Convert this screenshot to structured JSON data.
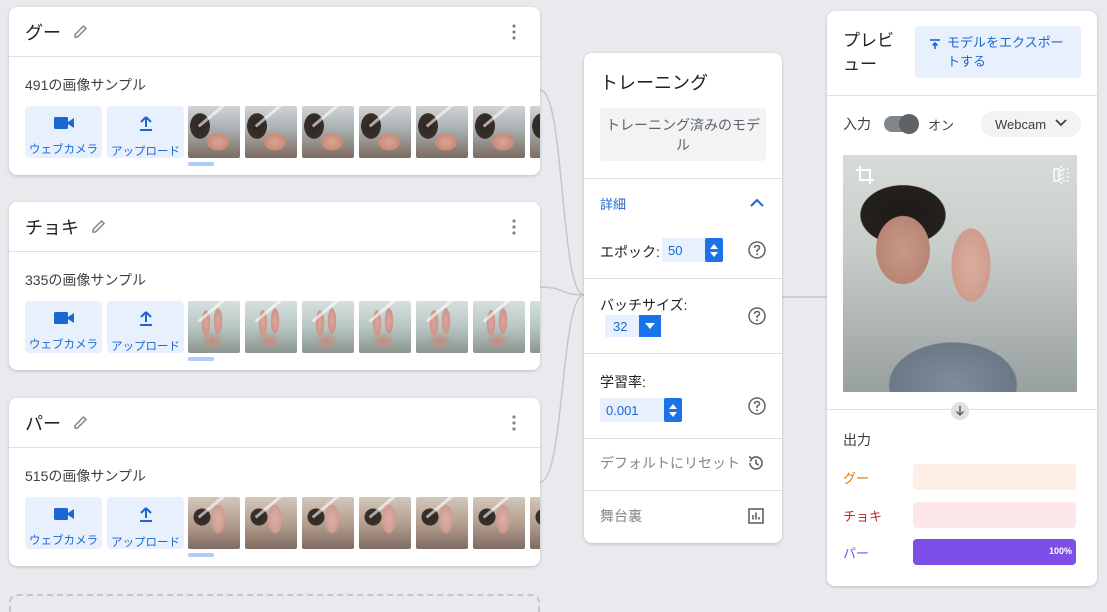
{
  "classes": [
    {
      "name": "グー",
      "samples": "491の画像サンプル",
      "thumb": "fist"
    },
    {
      "name": "チョキ",
      "samples": "335の画像サンプル",
      "thumb": "v"
    },
    {
      "name": "パー",
      "samples": "515の画像サンプル",
      "thumb": "palm"
    }
  ],
  "buttons": {
    "webcam": "ウェブカメラ",
    "upload": "アップロード"
  },
  "training": {
    "title": "トレーニング",
    "train_button": "トレーニング済みのモデル",
    "advanced": "詳細",
    "epochs_label": "エポック:",
    "epochs_value": "50",
    "batch_label": "バッチサイズ:",
    "batch_value": "32",
    "lr_label": "学習率:",
    "lr_value": "0.001",
    "reset": "デフォルトにリセット",
    "under_hood": "舞台裏"
  },
  "preview": {
    "title": "プレビュー",
    "export": "モデルをエクスポートする",
    "input_label": "入力",
    "toggle_state": "オン",
    "source": "Webcam",
    "output_label": "出力",
    "outputs": [
      {
        "name": "グー",
        "color": "#e37400",
        "bg": "#fdeee6",
        "fill": "",
        "value": 0,
        "pct": ""
      },
      {
        "name": "チョキ",
        "color": "#c5221f",
        "bg": "#fde7e9",
        "fill": "",
        "value": 0,
        "pct": ""
      },
      {
        "name": "パー",
        "color": "#7c4dff",
        "bg": "#ede7fe",
        "fill": "#7e4ee8",
        "value": 1.0,
        "pct": "100%"
      }
    ]
  },
  "colors": {
    "accent": "#1a73e8",
    "accent_bg": "#e8f0fe"
  }
}
